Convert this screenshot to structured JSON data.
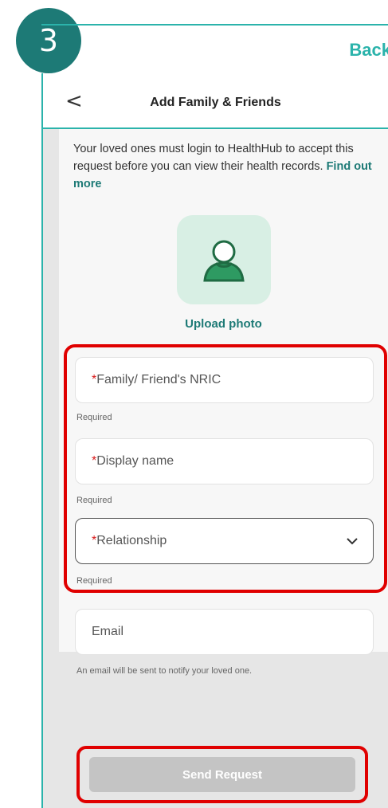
{
  "step": {
    "number": "3"
  },
  "back_link": "Back",
  "header": {
    "title": "Add Family & Friends",
    "back_glyph": "<"
  },
  "intro": {
    "text": "Your loved ones must login to HealthHub to accept this request before you can view their health records.",
    "link": "Find out more"
  },
  "avatar": {
    "icon": "person-icon",
    "upload_label": "Upload photo"
  },
  "form": {
    "nric": {
      "placeholder": "Family/ Friend's NRIC",
      "required_mark": "*",
      "helper": "Required"
    },
    "display_name": {
      "placeholder": "Display name",
      "required_mark": "*",
      "helper": "Required"
    },
    "relationship": {
      "placeholder": "Relationship",
      "required_mark": "*",
      "helper": "Required",
      "icon": "chevron-down-icon"
    },
    "email": {
      "placeholder": "Email",
      "helper": "An email will be sent to notify your loved one."
    }
  },
  "send_button": {
    "label": "Send Request"
  },
  "colors": {
    "accent": "#2bb3ab",
    "accent_dark": "#1d7a76",
    "highlight": "#e00000",
    "required": "#d81b1b",
    "disabled": "#c4c4c4"
  }
}
